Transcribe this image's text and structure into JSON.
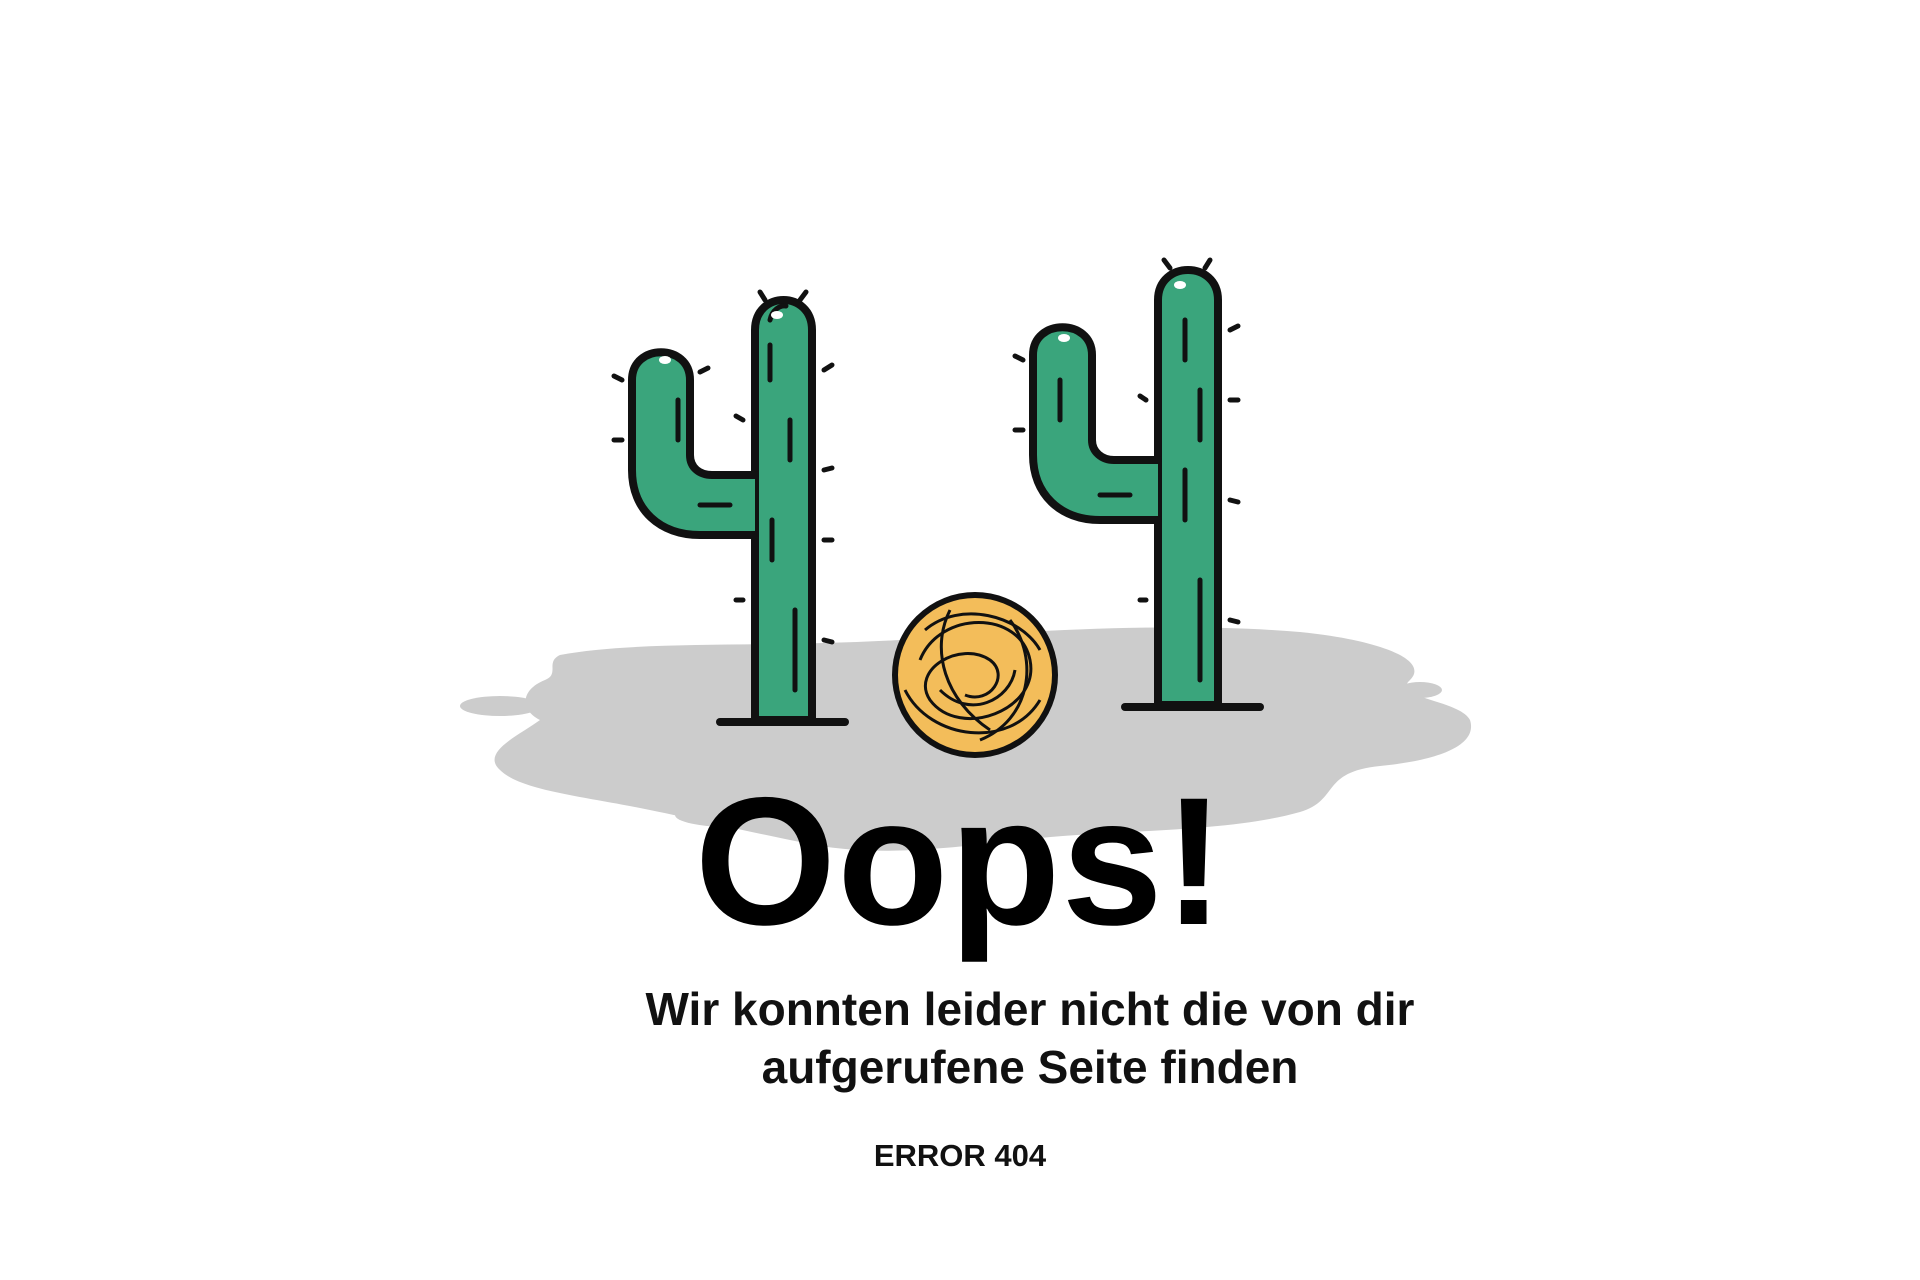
{
  "error_page": {
    "headline": "Oops!",
    "message": "Wir konnten leider nicht die von dir aufgerufene Seite finden",
    "error_code": "ERROR 404"
  },
  "illustration": {
    "icons": [
      "cactus-icon",
      "tumbleweed-icon",
      "cactus-icon"
    ],
    "colors": {
      "cactus": "#3aa57c",
      "outline": "#111111",
      "tumbleweed": "#f3bd5a",
      "ground_shadow": "#cccccc"
    }
  }
}
